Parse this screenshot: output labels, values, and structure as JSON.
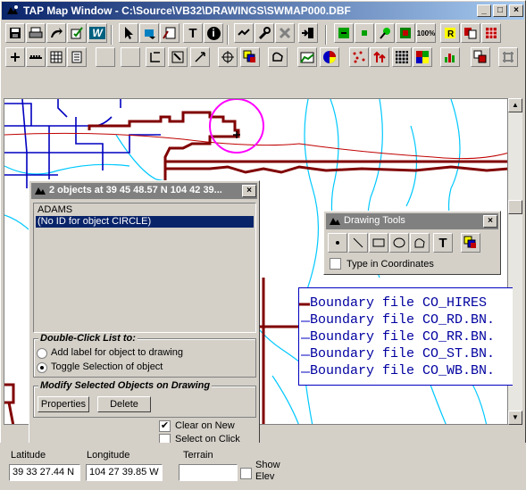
{
  "window": {
    "title": "TAP Map Window - C:\\Source\\VB32\\DRAWINGS\\SWMAP000.DBF",
    "min_label": "_",
    "max_label": "□",
    "close_label": "×"
  },
  "toolbar1": {
    "buttons": [
      "save",
      "print",
      "export",
      "edit-check",
      "w-tool",
      "pointer",
      "eraser-select",
      "data-edit",
      "text",
      "info",
      "pan-route",
      "query",
      "delete",
      "exit"
    ],
    "text_label": "T",
    "info_label": "i",
    "w_label": "W",
    "zoom_label": "100%"
  },
  "toolbar2": {
    "buttons": [
      "add",
      "scale",
      "grid",
      "notes",
      "fill",
      "line-tool",
      "zoom-window",
      "resize",
      "move",
      "overlay",
      "freehand",
      "area",
      "pie",
      "points",
      "arrows",
      "grid-color",
      "grid-layer",
      "bar-chart",
      "layers",
      "plus-grid"
    ]
  },
  "objects_dialog": {
    "title": "2 objects at  39 45 48.57 N 104 42 39...",
    "close_label": "×",
    "list_items": [
      "ADAMS",
      "(No ID for object CIRCLE)"
    ],
    "selected_index": 1,
    "double_click_group": "Double-Click List to:",
    "options": [
      "Add label for object to drawing",
      "Toggle Selection of  object"
    ],
    "selected_option": 1,
    "modify_group": "Modify Selected Objects on Drawing",
    "properties_label": "Properties",
    "delete_label": "Delete",
    "clear_on_new": "Clear on New",
    "clear_on_new_checked": true,
    "select_on_click": "Select on Click",
    "select_on_click_checked": false
  },
  "drawing_tools": {
    "title": "Drawing Tools",
    "close_label": "×",
    "tools": [
      "point",
      "line",
      "rectangle",
      "ellipse",
      "polygon",
      "text",
      "color"
    ],
    "text_tool_label": "T",
    "type_coords_label": "Type in Coordinates",
    "type_coords_checked": false
  },
  "legend": {
    "rows": [
      "Boundary file CO_HIRES",
      "Boundary file CO_RD.BN.",
      "Boundary file CO_RR.BN.",
      "Boundary file CO_ST.BN.",
      "Boundary file CO_WB.BN."
    ],
    "colors": [
      "#800000",
      "#0000c0",
      "#0000c0",
      "#0000c0",
      "#0000c0"
    ]
  },
  "status": {
    "latitude_label": "Latitude",
    "latitude_value": "39 33 27.44 N",
    "longitude_label": "Longitude",
    "longitude_value": "104 27 39.85 W",
    "terrain_label": "Terrain",
    "terrain_value": "",
    "show_elev_label_1": "Show",
    "show_elev_label_2": "Elev"
  },
  "colors": {
    "road": "#800000",
    "stream": "#00c8ff",
    "street": "#0000c0",
    "circle": "#ff00ff",
    "title_active": "#0a246a",
    "title_inactive": "#808080"
  }
}
